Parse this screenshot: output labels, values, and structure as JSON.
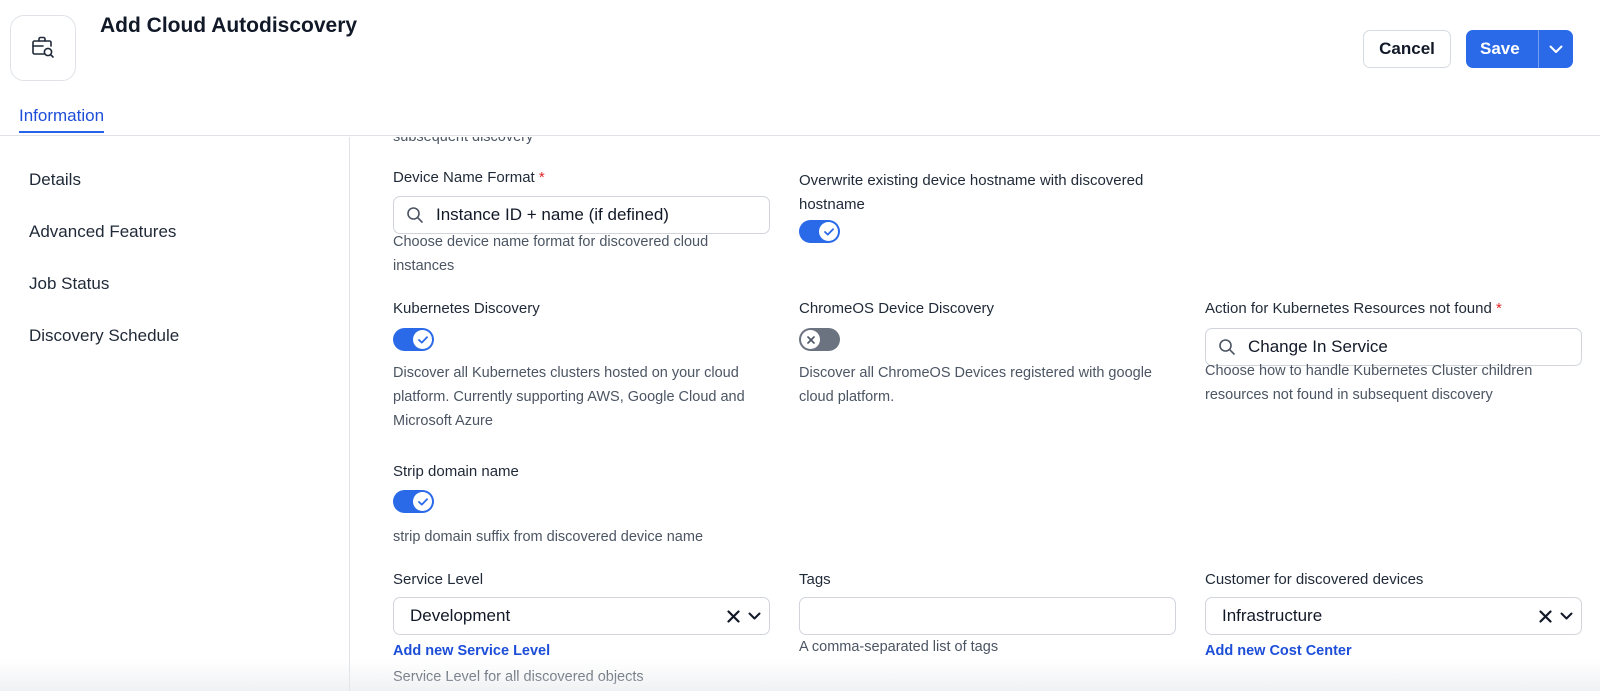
{
  "header": {
    "title": "Add Cloud Autodiscovery",
    "icon": "briefcase-search-icon",
    "cancel_label": "Cancel",
    "save_label": "Save"
  },
  "tabs": [
    {
      "label": "Information",
      "active": true
    }
  ],
  "sidebar": {
    "items": [
      {
        "label": "Details"
      },
      {
        "label": "Advanced Features"
      },
      {
        "label": "Job Status"
      },
      {
        "label": "Discovery Schedule"
      }
    ]
  },
  "form": {
    "truncated_help": "subsequent discovery",
    "device_name_format": {
      "label": "Device Name Format",
      "required_mark": "*",
      "value": "Instance ID + name (if defined)",
      "help": "Choose device name format for discovered cloud instances"
    },
    "overwrite_hostname": {
      "label": "Overwrite existing device hostname with discovered hostname",
      "enabled": true
    },
    "kubernetes_discovery": {
      "label": "Kubernetes Discovery",
      "enabled": true,
      "help": "Discover all Kubernetes clusters hosted on your cloud platform. Currently supporting AWS, Google Cloud and Microsoft Azure"
    },
    "chromeos_discovery": {
      "label": "ChromeOS Device Discovery",
      "enabled": false,
      "help": "Discover all ChromeOS Devices registered with google cloud platform."
    },
    "k8s_not_found_action": {
      "label": "Action for Kubernetes Resources not found",
      "required_mark": "*",
      "value": "Change In Service",
      "help": "Choose how to handle Kubernetes Cluster children resources not found in subsequent discovery"
    },
    "strip_domain": {
      "label": "Strip domain name",
      "enabled": true,
      "help": "strip domain suffix from discovered device name"
    },
    "service_level": {
      "label": "Service Level",
      "value": "Development",
      "add_link": "Add new Service Level",
      "help": "Service Level for all discovered objects"
    },
    "tags": {
      "label": "Tags",
      "value": "",
      "help": "A comma-separated list of tags"
    },
    "customer": {
      "label": "Customer for discovered devices",
      "value": "Infrastructure",
      "add_link": "Add new Cost Center"
    }
  },
  "colors": {
    "accent": "#2a6ae9",
    "link": "#1d4ed8",
    "required": "#dc2626",
    "toggle_off": "#6b7280"
  }
}
